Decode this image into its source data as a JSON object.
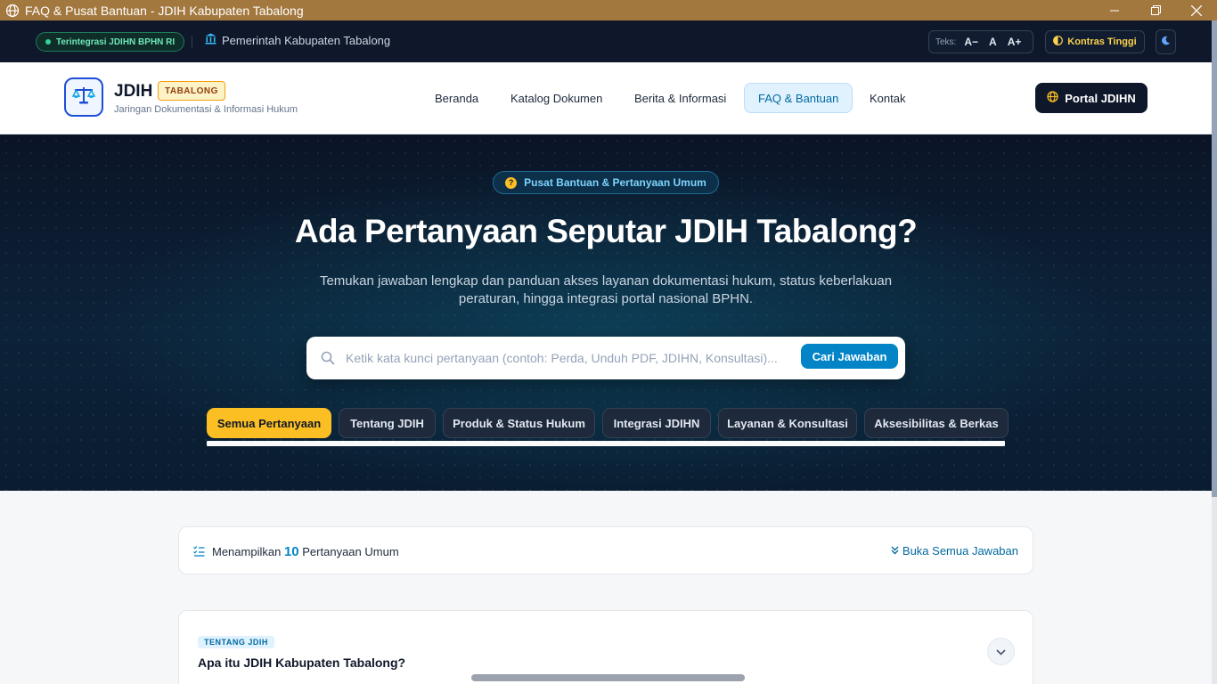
{
  "window": {
    "title": "FAQ & Pusat Bantuan - JDIH Kabupaten Tabalong"
  },
  "utility": {
    "integration_badge": "Terintegrasi JDIHN BPHN RI",
    "government": "Pemerintah Kabupaten Tabalong",
    "text_size_label": "Teks:",
    "text_decrease": "A−",
    "text_normal": "A",
    "text_increase": "A+",
    "high_contrast": "Kontras Tinggi"
  },
  "header": {
    "brand": "JDIH",
    "brand_tag": "TABALONG",
    "brand_sub": "Jaringan Dokumentasi & Informasi Hukum",
    "nav": [
      "Beranda",
      "Katalog Dokumen",
      "Berita & Informasi",
      "FAQ & Bantuan",
      "Kontak"
    ],
    "portal_button": "Portal JDIHN"
  },
  "hero": {
    "pill": "Pusat Bantuan & Pertanyaan Umum",
    "title": "Ada Pertanyaan Seputar JDIH Tabalong?",
    "description": "Temukan jawaban lengkap dan panduan akses layanan dokumentasi hukum, status keberlakuan peraturan, hingga integrasi portal nasional BPHN.",
    "search_placeholder": "Ketik kata kunci pertanyaan (contoh: Perda, Unduh PDF, JDIHN, Konsultasi)...",
    "search_button": "Cari Jawaban",
    "tabs": [
      "Semua Pertanyaan",
      "Tentang JDIH",
      "Produk & Status Hukum",
      "Integrasi JDIHN",
      "Layanan & Konsultasi",
      "Aksesibilitas & Berkas"
    ]
  },
  "results": {
    "prefix": "Menampilkan",
    "count": "10",
    "suffix": "Pertanyaan Umum",
    "open_all": "Buka Semua Jawaban"
  },
  "faqs": [
    {
      "category": "TENTANG JDIH",
      "question": "Apa itu JDIH Kabupaten Tabalong?"
    }
  ],
  "colors": {
    "accent": "#0284c7",
    "active_tab": "#fbbf24",
    "hero_bg": "#0c2238",
    "titlebar": "#a3783f"
  }
}
